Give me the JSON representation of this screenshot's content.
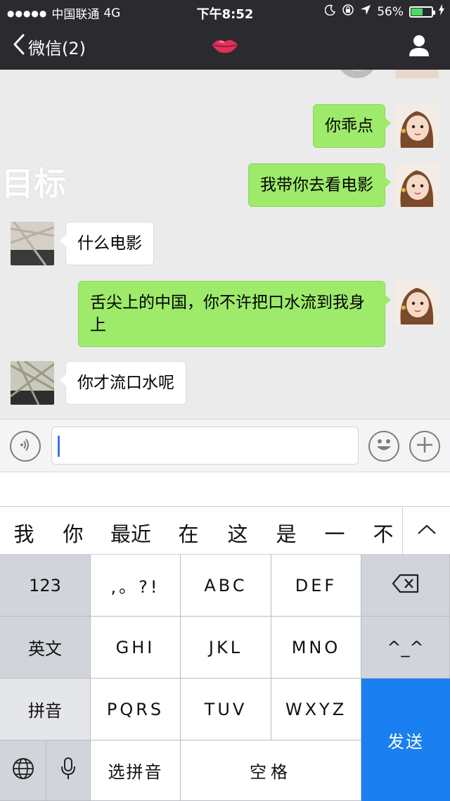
{
  "status_bar": {
    "signal_dots": "●●●●●",
    "carrier": "中国联通",
    "network": "4G",
    "time": "下午8:52",
    "battery_percent": "56%",
    "battery_level": 0.56
  },
  "nav": {
    "back_label": "微信(2)",
    "title_icon": "lips-icon",
    "profile_icon": "person-icon"
  },
  "chat": {
    "watermark": "目标",
    "messages": [
      {
        "side": "me",
        "text": "你乖点"
      },
      {
        "side": "me",
        "text": "我带你去看电影"
      },
      {
        "side": "other",
        "text": "什么电影"
      },
      {
        "side": "me",
        "text": "舌尖上的中国，你不许把口水流到我身上"
      },
      {
        "side": "other",
        "text": "你才流口水呢"
      }
    ]
  },
  "input_bar": {
    "voice_icon": "voice-icon",
    "input_value": "",
    "emoji_icon": "emoji-icon",
    "plus_icon": "plus-icon"
  },
  "candidates": {
    "items": [
      "我",
      "你",
      "最近",
      "在",
      "这",
      "是",
      "一",
      "不"
    ],
    "expand_icon": "chevron-up-icon"
  },
  "keyboard": {
    "row1": [
      "123",
      ",。?!",
      "ABC",
      "DEF"
    ],
    "backspace_icon": "backspace-icon",
    "row2": [
      "英文",
      "GHI",
      "JKL",
      "MNO",
      "^_^"
    ],
    "row3": [
      "拼音",
      "PQRS",
      "TUV",
      "WXYZ"
    ],
    "send": "发送",
    "globe_icon": "globe-icon",
    "mic_icon": "mic-icon",
    "select_pinyin": "选拼音",
    "space": "空格"
  },
  "colors": {
    "nav_bg": "#2b2b2f",
    "my_bubble": "#9eea6a",
    "other_bubble": "#ffffff",
    "send_key": "#1a7ff0",
    "caret": "#3b76f0"
  }
}
